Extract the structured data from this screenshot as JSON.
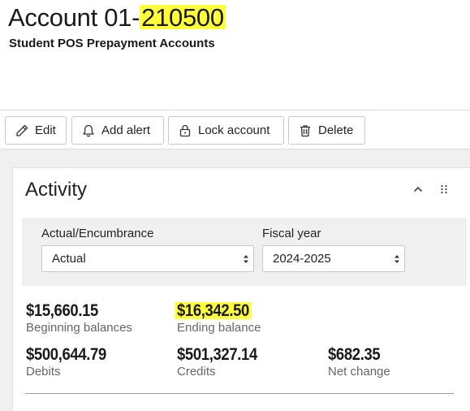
{
  "header": {
    "title_prefix": "Account 01-",
    "title_highlight": "210500",
    "subtitle": "Student POS Prepayment Accounts"
  },
  "toolbar": {
    "edit_label": "Edit",
    "add_alert_label": "Add alert",
    "lock_label": "Lock account",
    "delete_label": "Delete"
  },
  "activity": {
    "title": "Activity",
    "filters": {
      "actual_label": "Actual/Encumbrance",
      "actual_value": "Actual",
      "fiscal_label": "Fiscal year",
      "fiscal_value": "2024-2025"
    },
    "stats": {
      "beginning_value": "$15,660.15",
      "beginning_label": "Beginning balances",
      "ending_value": "$16,342.50",
      "ending_label": "Ending balance",
      "debits_value": "$500,644.79",
      "debits_label": "Debits",
      "credits_value": "$501,327.14",
      "credits_label": "Credits",
      "net_value": "$682.35",
      "net_label": "Net change"
    }
  },
  "colors": {
    "highlight": "#ffff3a",
    "panel_bg": "#f0f0f0"
  }
}
